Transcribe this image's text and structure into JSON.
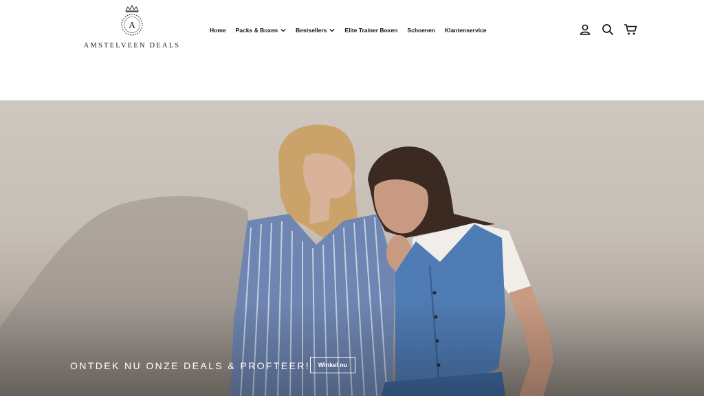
{
  "brand": {
    "name": "AMSTELVEEN DEALS",
    "monogram": "A",
    "logo_alt": "Amstelveen Deals logo"
  },
  "nav": {
    "items": [
      {
        "label": "Home",
        "has_dropdown": false
      },
      {
        "label": "Packs & Boxen",
        "has_dropdown": true
      },
      {
        "label": "Bestsellers",
        "has_dropdown": true
      },
      {
        "label": "Elite Trainer Boxen",
        "has_dropdown": false
      },
      {
        "label": "Schoenen",
        "has_dropdown": false
      },
      {
        "label": "Klantenservice",
        "has_dropdown": false
      }
    ]
  },
  "header_icons": [
    "account-icon",
    "search-icon",
    "cart-icon"
  ],
  "hero": {
    "headline": "ONTDEK NU ONZE DEALS & PROFTEER!",
    "cta_label": "Winkel nu",
    "image_description": "two women posing against a beige wall, one in a blue striped shirt and one in a denim vest"
  },
  "colors": {
    "text": "#111111",
    "background": "#ffffff",
    "hero_wall": "#c6beb5",
    "hero_text": "#ffffff"
  }
}
